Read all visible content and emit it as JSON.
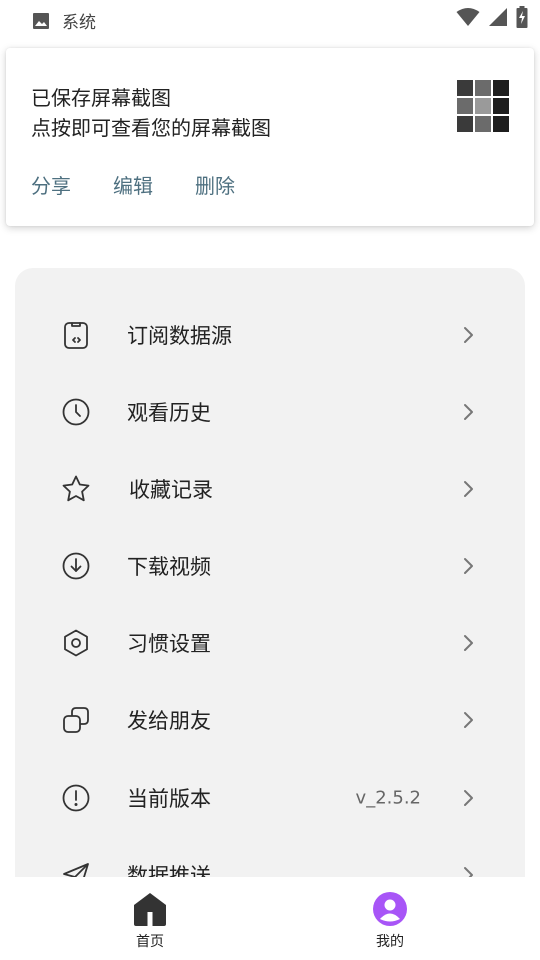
{
  "status_bar": {
    "app_label": "系统",
    "icons": [
      "image-icon",
      "wifi-icon",
      "cellular-signal-icon",
      "battery-charging-icon"
    ]
  },
  "notification": {
    "title": "已保存屏幕截图",
    "subtitle": "点按即可查看您的屏幕截图",
    "actions": {
      "share": "分享",
      "edit": "编辑",
      "delete": "删除"
    },
    "action_color": "#4e7080"
  },
  "menu": {
    "items": [
      {
        "icon": "subscription-source-icon",
        "label": "订阅数据源"
      },
      {
        "icon": "clock-icon",
        "label": "观看历史"
      },
      {
        "icon": "star-icon",
        "label": "收藏记录"
      },
      {
        "icon": "download-icon",
        "label": "下载视频"
      },
      {
        "icon": "settings-hexagon-icon",
        "label": "习惯设置"
      },
      {
        "icon": "share-copy-icon",
        "label": "发给朋友"
      },
      {
        "icon": "info-exclamation-icon",
        "label": "当前版本",
        "value": "v_2.5.2"
      },
      {
        "icon": "paper-plane-icon",
        "label": "数据推送"
      }
    ]
  },
  "bottom_nav": {
    "tabs": [
      {
        "label": "首页",
        "icon": "home-icon",
        "active": false
      },
      {
        "label": "我的",
        "icon": "user-profile-icon",
        "active": true
      }
    ],
    "active_color": "#a855f7"
  }
}
